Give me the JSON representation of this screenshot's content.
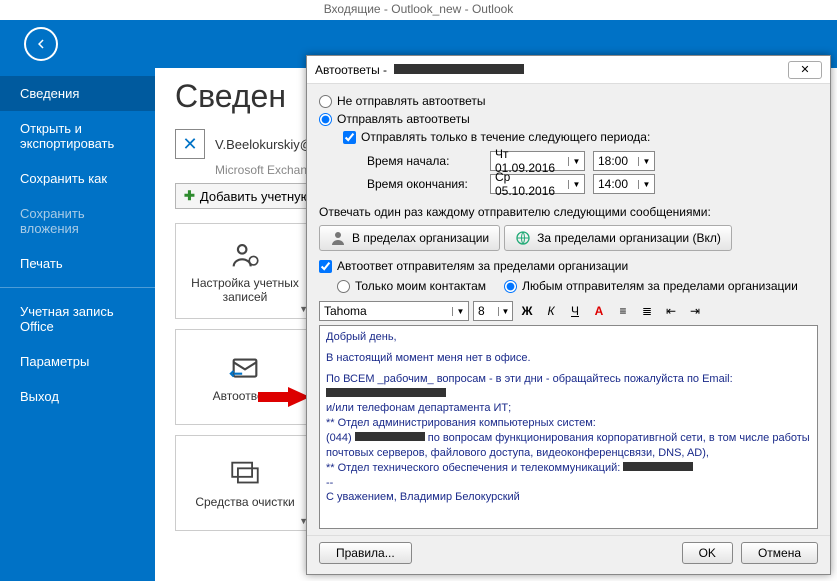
{
  "window_title": "Входящие - Outlook_new - Outlook",
  "page_title": "Сведен",
  "sidebar": {
    "items": [
      {
        "label": "Сведения",
        "active": true
      },
      {
        "label": "Открыть и экспортировать"
      },
      {
        "label": "Сохранить как"
      },
      {
        "label": "Сохранить вложения",
        "disabled": true
      },
      {
        "label": "Печать"
      },
      {
        "sep": true
      },
      {
        "label": "Учетная запись Office"
      },
      {
        "label": "Параметры"
      },
      {
        "label": "Выход"
      }
    ]
  },
  "account": {
    "name": "V.Beelokurskiy@",
    "sub": "Microsoft Exchan"
  },
  "add_account": "Добавить учетную",
  "tiles": [
    {
      "label": "Настройка учетных записей"
    },
    {
      "label": "Автоответы"
    },
    {
      "label": "Средства очистки"
    }
  ],
  "dialog": {
    "title_prefix": "Автоответы - ",
    "opt_off": "Не отправлять автоответы",
    "opt_on": "Отправлять автоответы",
    "period_check": "Отправлять только в течение следующего периода:",
    "start_label": "Время начала:",
    "start_date": "Чт 01.09.2016",
    "start_time": "18:00",
    "end_label": "Время окончания:",
    "end_date": "Ср 05.10.2016",
    "end_time": "14:00",
    "reply_label": "Отвечать один раз каждому отправителю следующими сообщениями:",
    "tab_inside": "В пределах организации",
    "tab_outside": "За пределами организации (Вкл)",
    "outside_check": "Автоответ отправителям за пределами организации",
    "only_contacts": "Только моим контактам",
    "any_sender": "Любым отправителям за пределами организации",
    "font": "Tahoma",
    "size": "8",
    "fmt_bold": "Ж",
    "fmt_italic": "К",
    "fmt_underline": "Ч",
    "msg_line1": "Добрый день,",
    "msg_line2": "В настоящий момент меня нет в офисе.",
    "msg_line3": "По ВСЕМ _рабочим_ вопросам - в эти дни - обращайтесь пожалуйста по Email:",
    "msg_line4": "и/или телефонам департамента ИТ;",
    "msg_line5": "** Отдел администрирования компьютерных систем:",
    "msg_line6a": "(044) ",
    "msg_line6b": " по вопросам функционирования корпоративгной сети, в том числе работы почтовых серверов, файлового доступа, видеоконференцсвязи, DNS, AD),",
    "msg_line7": "** Отдел технического обеспечения и телекоммуникаций: ",
    "msg_sig": "С уважением, Владимир Белокурский",
    "rules_btn": "Правила...",
    "ok_btn": "OK",
    "cancel_btn": "Отмена"
  }
}
